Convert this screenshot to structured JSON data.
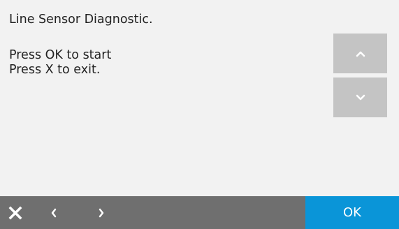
{
  "message": {
    "title": "Line Sensor Diagnostic.",
    "lines": [
      "Press OK to start",
      "Press X to exit."
    ]
  },
  "scroll": {
    "up_icon": "chevron-up-icon",
    "down_icon": "chevron-down-icon"
  },
  "bottom_bar": {
    "exit_icon": "close-icon",
    "prev_icon": "chevron-left-icon",
    "next_icon": "chevron-right-icon",
    "ok_label": "OK"
  },
  "colors": {
    "background": "#f2f2f2",
    "scroll_button": "#c4c4c4",
    "nav_bar": "#6f6f6f",
    "ok_button": "#0a95d8",
    "text": "#222222"
  }
}
